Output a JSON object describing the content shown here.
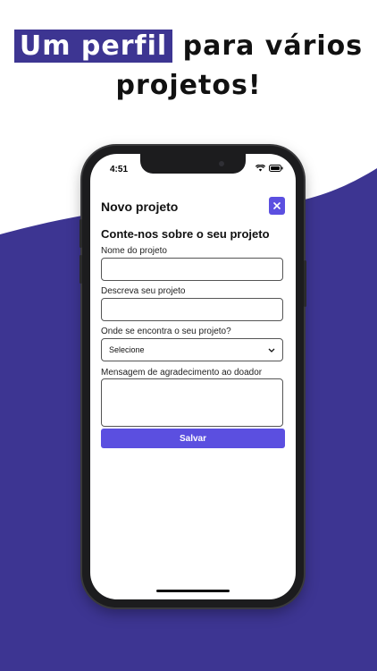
{
  "headline": {
    "highlight": "Um perfil",
    "line1_rest": " para vários",
    "line2": "projetos!"
  },
  "colors": {
    "brand_purple": "#3d3592",
    "button_purple": "#5b4fe0"
  },
  "status_bar": {
    "time": "4:51",
    "icons": [
      "wifi-icon",
      "battery-icon"
    ]
  },
  "modal": {
    "title": "Novo projeto",
    "close_icon": "close-icon",
    "subtitle": "Conte-nos sobre o seu projeto",
    "fields": {
      "name_label": "Nome do projeto",
      "name_value": "",
      "description_label": "Descreva seu projeto",
      "description_value": "",
      "location_label": "Onde se encontra o seu projeto?",
      "location_selected": "Selecione",
      "thanks_label": "Mensagem de agradecimento ao doador",
      "thanks_value": ""
    },
    "save_label": "Salvar"
  }
}
